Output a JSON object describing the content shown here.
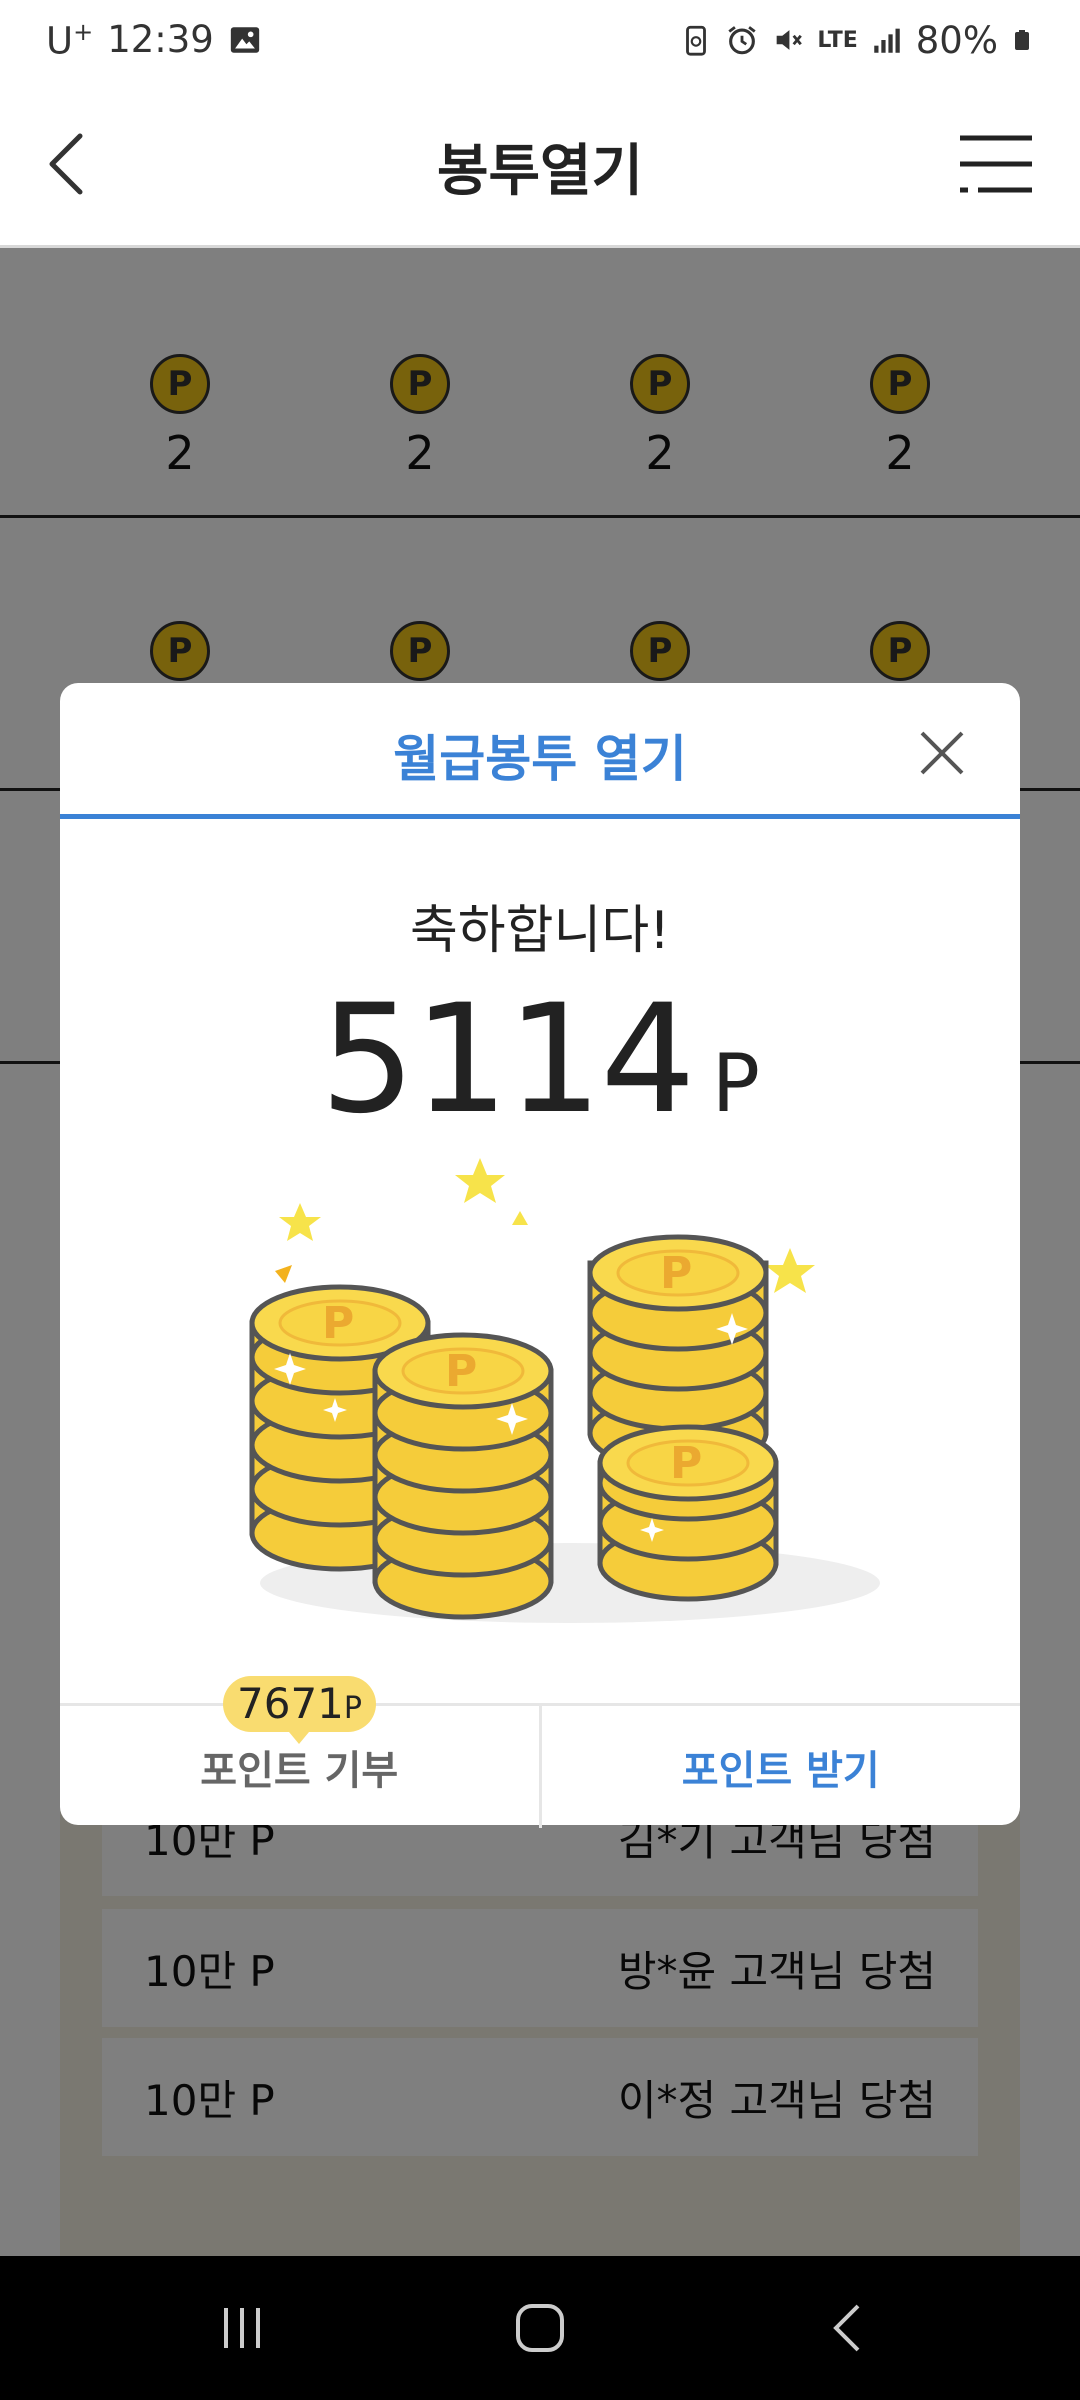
{
  "status_bar": {
    "carrier": "U",
    "carrier_plus": "+",
    "time": "12:39",
    "network": "LTE",
    "battery": "80%"
  },
  "header": {
    "title": "봉투열기"
  },
  "background": {
    "coin_rows": [
      {
        "label": "P",
        "values": [
          "2",
          "2",
          "2",
          "2"
        ]
      },
      {
        "label": "P",
        "values": [
          "",
          "",
          "",
          ""
        ]
      }
    ],
    "winners": [
      {
        "prize": "10만 P",
        "name": "김*기 고객님 당첨"
      },
      {
        "prize": "10만 P",
        "name": "방*윤 고객님 당첨"
      },
      {
        "prize": "10만 P",
        "name": "이*정 고객님 당첨"
      }
    ]
  },
  "modal": {
    "title": "월급봉투 열기",
    "congrats": "축하합니다!",
    "points": "5114",
    "points_unit": "P",
    "coin_label": "P",
    "donate_badge_value": "7671",
    "donate_badge_unit": "P",
    "donate_label": "포인트 기부",
    "receive_label": "포인트 받기"
  },
  "colors": {
    "accent": "#3b82d6",
    "coin_gold": "#f9d649",
    "badge": "#f9dc70"
  },
  "icons": {
    "back": "back-arrow-icon",
    "menu": "menu-icon",
    "close": "close-icon"
  }
}
